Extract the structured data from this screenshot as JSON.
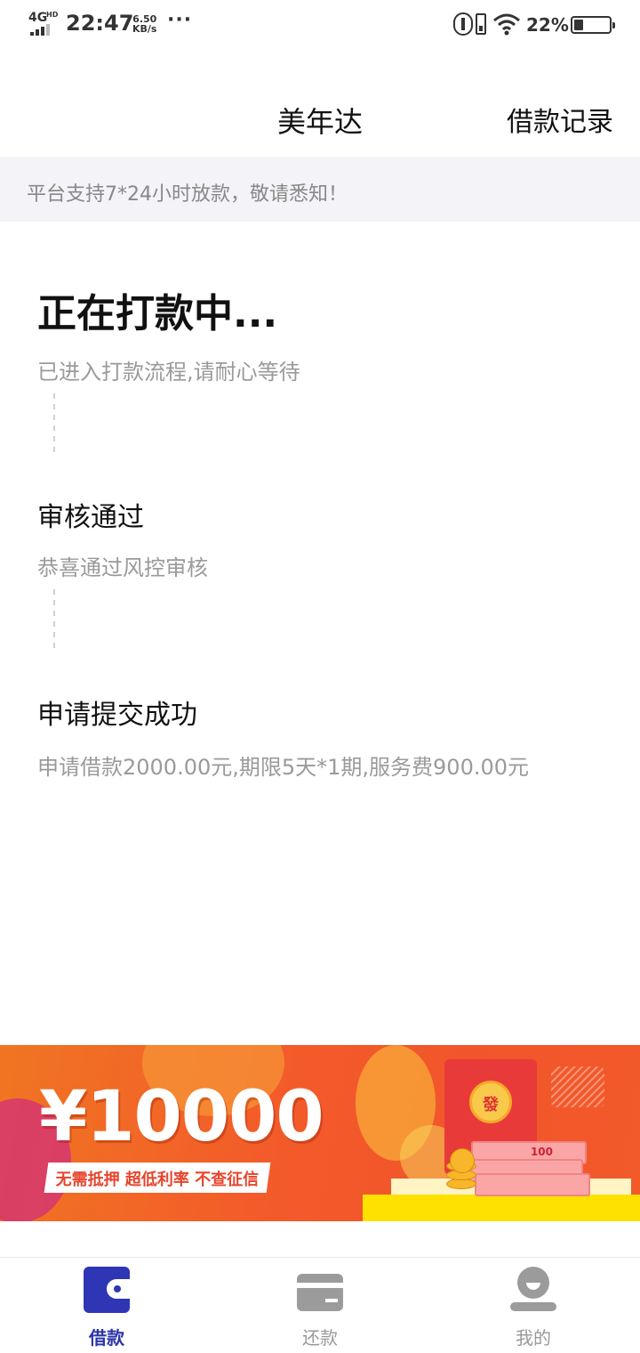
{
  "status_bar": {
    "network": "4G",
    "network_badge": "HD",
    "time": "22:47",
    "speed_value": "6.50",
    "speed_unit": "KB/s",
    "more": "···",
    "battery_percent": "22%"
  },
  "header": {
    "title": "美年达",
    "record_link": "借款记录"
  },
  "notice": {
    "text": "平台支持7*24小时放款，敬请悉知！"
  },
  "timeline": [
    {
      "title": "正在打款中...",
      "desc": "已进入打款流程,请耐心等待"
    },
    {
      "title": "审核通过",
      "desc": "恭喜通过风控审核"
    },
    {
      "title": "申请提交成功",
      "desc": "申请借款2000.00元,期限5天*1期,服务费900.00元"
    }
  ],
  "banner": {
    "amount": "¥10000",
    "tagline": "无需抵押  超低利率  不查征信",
    "envelope_char": "發",
    "cash_value": "100"
  },
  "tabs": [
    {
      "label": "借款",
      "icon": "wallet-icon",
      "active": true
    },
    {
      "label": "还款",
      "icon": "card-icon",
      "active": false
    },
    {
      "label": "我的",
      "icon": "person-icon",
      "active": false
    }
  ],
  "colors": {
    "accent": "#2e36b6",
    "banner_orange": "#f35a2a",
    "muted_text": "#9a9a9a"
  }
}
